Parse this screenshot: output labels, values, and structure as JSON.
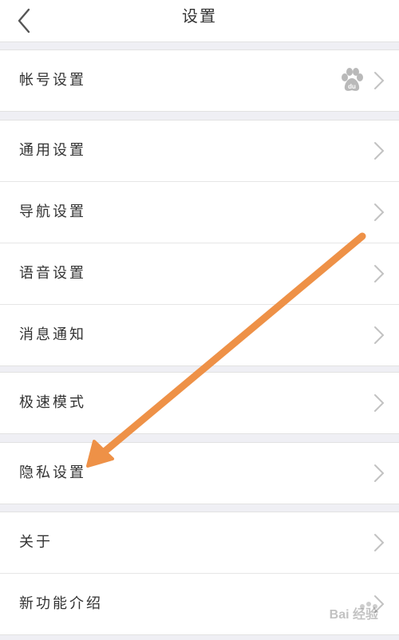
{
  "header": {
    "title": "设置",
    "back_icon": "back-chevron-icon"
  },
  "groups": [
    {
      "items": [
        {
          "label": "帐号设置",
          "trailing_icon": "baidu-paw-icon"
        }
      ]
    },
    {
      "items": [
        {
          "label": "通用设置"
        },
        {
          "label": "导航设置"
        },
        {
          "label": "语音设置"
        },
        {
          "label": "消息通知"
        }
      ]
    },
    {
      "items": [
        {
          "label": "极速模式"
        }
      ]
    },
    {
      "items": [
        {
          "label": "隐私设置"
        }
      ]
    },
    {
      "items": [
        {
          "label": "关于"
        },
        {
          "label": "新功能介绍"
        }
      ]
    }
  ],
  "annotation": {
    "color": "#ee9147",
    "points_to": "隐私设置"
  },
  "watermark": {
    "text": "Bai 经验"
  }
}
